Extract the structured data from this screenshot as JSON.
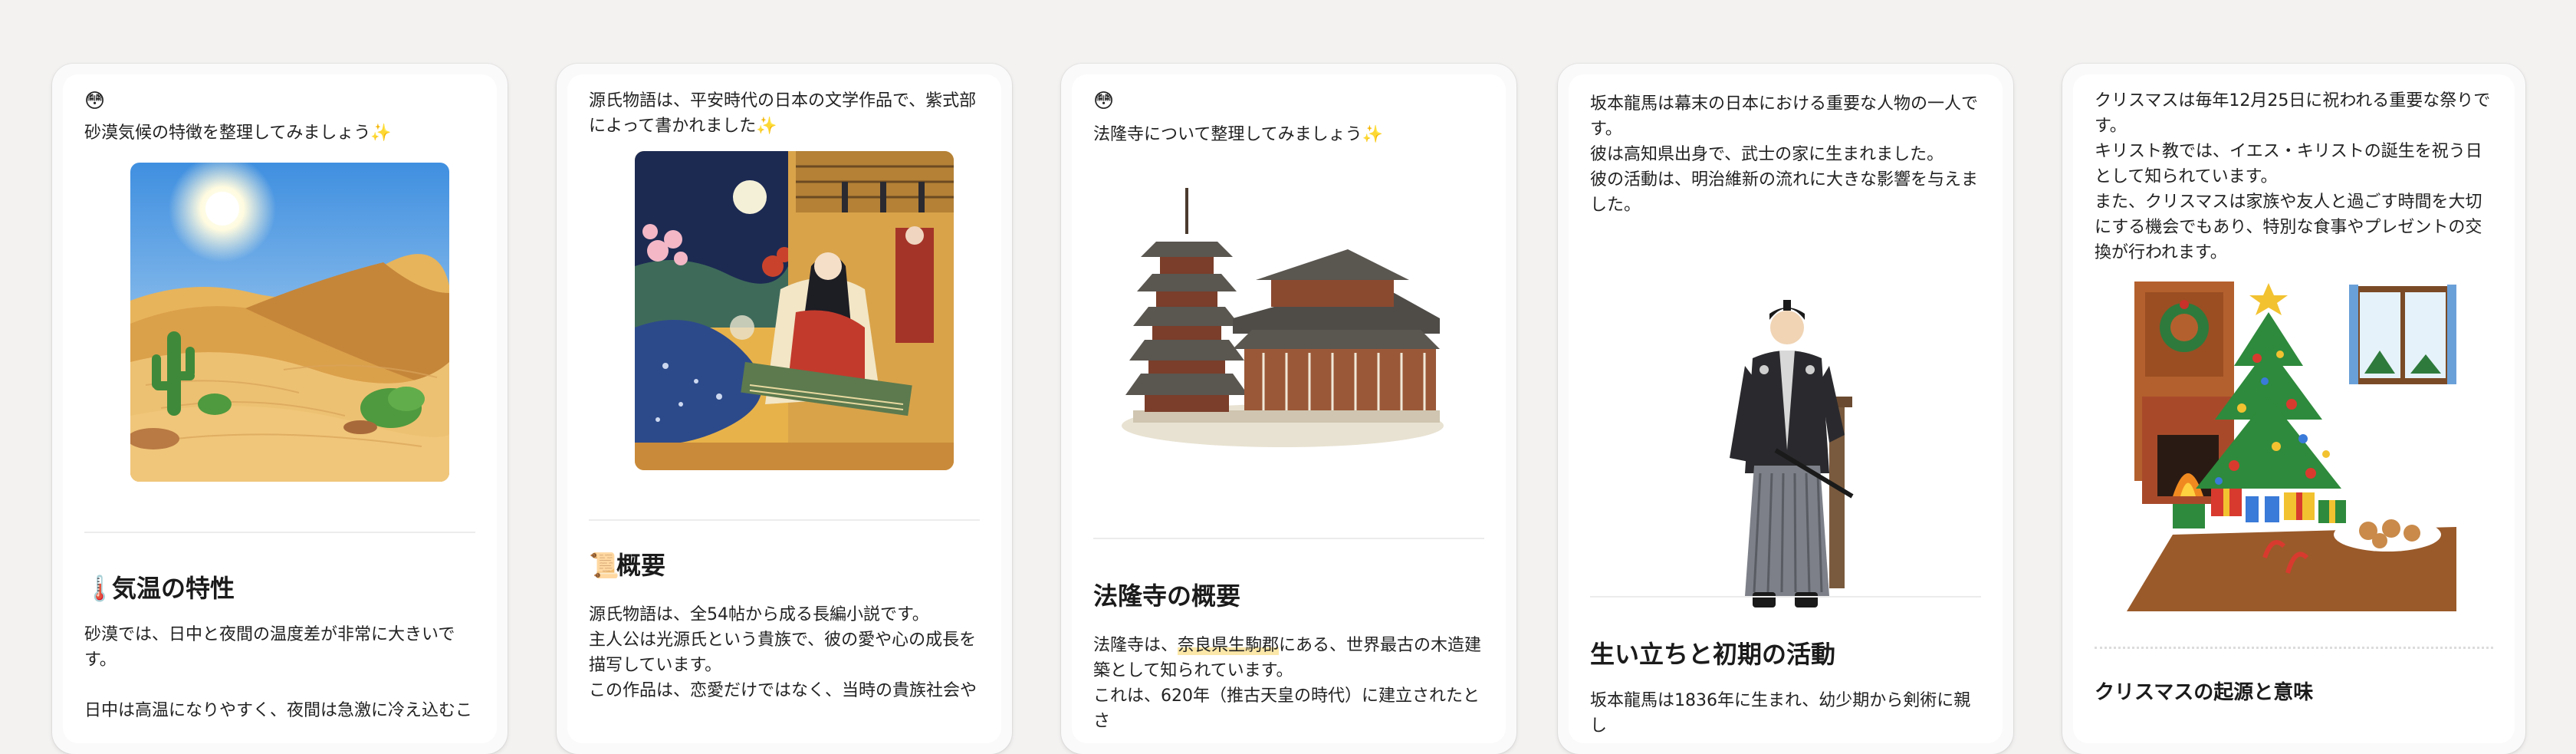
{
  "cards": [
    {
      "emoji": "😳",
      "intro": [
        "砂漠気候の特徴を整理してみましょう✨"
      ],
      "image": "desert-illustration",
      "heading_icon": "🌡️",
      "heading": "気温の特性",
      "body": [
        "砂漠では、日中と夜間の温度差が非常に大きいです。",
        "",
        "日中は高温になりやすく、夜間は急激に冷え込むこ"
      ]
    },
    {
      "intro": [
        "源氏物語は、平安時代の日本の文学作品で、紫式部",
        "によって書かれました✨"
      ],
      "image": "heian-lady-koto-illustration",
      "heading_icon": "📜",
      "heading": "概要",
      "body": [
        "源氏物語は、全54帖から成る長編小説です。",
        "主人公は光源氏という貴族で、彼の愛や心の成長を",
        "描写しています。",
        "この作品は、恋愛だけではなく、当時の貴族社会や"
      ]
    },
    {
      "emoji": "😳",
      "intro": [
        "法隆寺について整理してみましょう✨"
      ],
      "image": "horyuji-temple-illustration",
      "heading": "法隆寺の概要",
      "body": [
        "法隆寺は、奈良県生駒郡にある、世界最古の木造建",
        "築として知られています。",
        "これは、620年（推古天皇の時代）に建立されたとさ"
      ],
      "highlight": "奈良県生駒郡"
    },
    {
      "intro": [
        "坂本龍馬は幕末の日本における重要な人物の一人で",
        "す。",
        "彼は高知県出身で、武士の家に生まれました。",
        "彼の活動は、明治維新の流れに大きな影響を与えま",
        "した。"
      ],
      "image": "samurai-ryoma-illustration",
      "heading": "生い立ちと初期の活動",
      "body": [
        "坂本龍馬は1836年に生まれ、幼少期から剣術に親し"
      ]
    },
    {
      "intro": [
        "クリスマスは毎年12月25日に祝われる重要な祭りで",
        "す。",
        "キリスト教では、イエス・キリストの誕生を祝う日",
        "として知られています。",
        "また、クリスマスは家族や友人と過ごす時間を大切",
        "にする機会でもあり、特別な食事やプレゼントの交",
        "換が行われます。"
      ],
      "image": "christmas-tree-illustration",
      "heading": "クリスマスの起源と意味",
      "body": []
    }
  ]
}
